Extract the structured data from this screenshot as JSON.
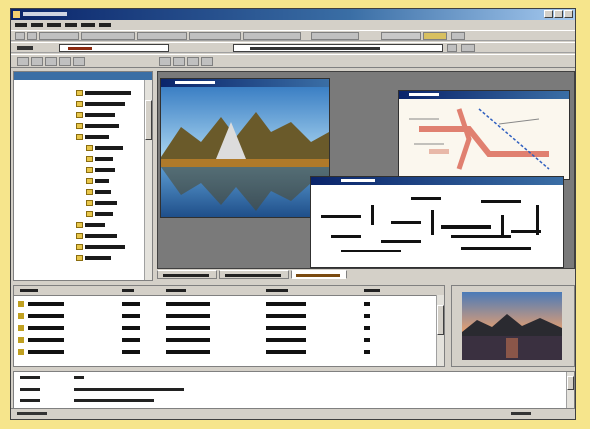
{
  "window": {
    "title": ""
  },
  "menu": {
    "items": []
  },
  "toolbars": {
    "address_value": "",
    "search_value": ""
  },
  "tree": {
    "items": []
  },
  "viewer": {
    "photo_window_title": "",
    "map_window_title": "",
    "diagram_window_title": ""
  },
  "tabs": {
    "labels": []
  },
  "table": {
    "columns": [],
    "rows": []
  },
  "output": {
    "lines": []
  },
  "status": {
    "text": ""
  },
  "colors": {
    "accent": "#0a246a",
    "background": "#f6e58c"
  },
  "icons": [
    "folder-icon",
    "close-icon",
    "minimize-icon",
    "maximize-icon"
  ]
}
